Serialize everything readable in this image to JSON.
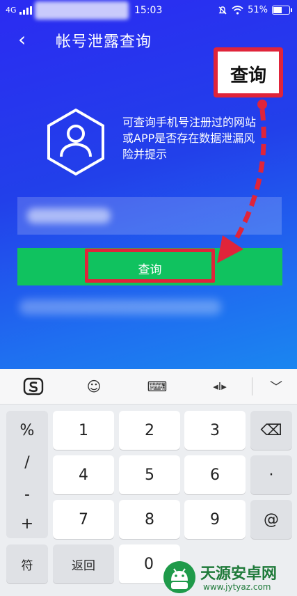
{
  "status_bar": {
    "network": "4G",
    "time": "15:03",
    "battery": "51%",
    "battery_level": 0.51
  },
  "header": {
    "back_icon": "‹",
    "title": "帐号泄露查询"
  },
  "description": {
    "text": "可查询手机号注册过的网站或APP是否存在数据泄漏风险并提示"
  },
  "phone_input": {
    "value": ""
  },
  "query_button": {
    "label": "查询"
  },
  "callout": {
    "label": "查询"
  },
  "annotation_color": "#e0243a",
  "keyboard": {
    "toolbar": {
      "sogou_icon": "S",
      "emoji_icon": "☺",
      "keyboard_icon": "⌨",
      "cursor_icon": "◂I▸",
      "collapse_icon": "﹀"
    },
    "symbols": [
      "%",
      "/",
      "-",
      "+"
    ],
    "keys_row1": [
      "1",
      "2",
      "3"
    ],
    "keys_row2": [
      "4",
      "5",
      "6"
    ],
    "keys_row3": [
      "7",
      "8",
      "9"
    ],
    "dot": "·",
    "at": "@",
    "backspace_icon": "⌫",
    "symbol_key": "符",
    "return_key": "返回",
    "zero_key": "0"
  },
  "watermark": {
    "site_name": "天源安卓网",
    "site_url": "www.jytyaz.com"
  }
}
